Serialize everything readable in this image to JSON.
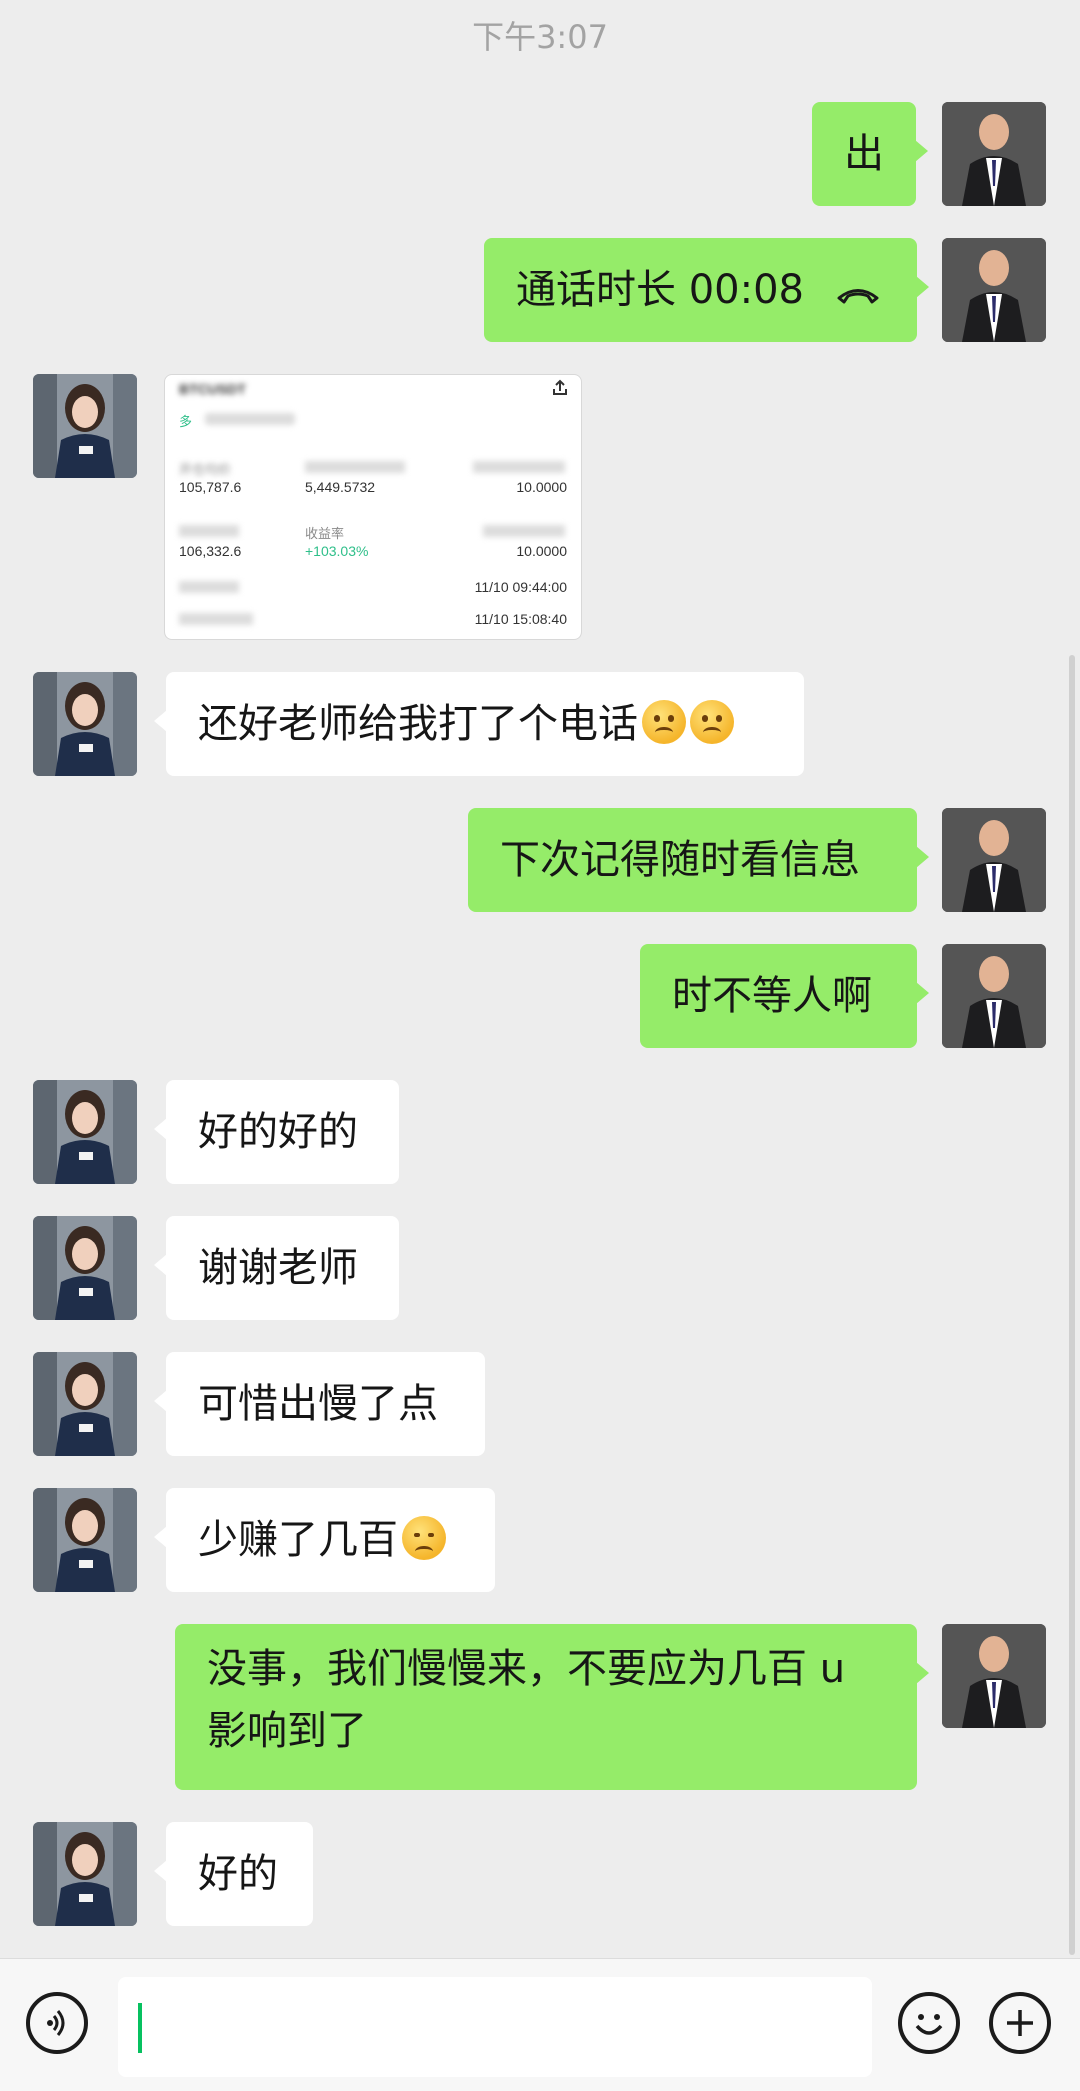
{
  "timestamp": "下午3:07",
  "messages": [
    {
      "side": "me",
      "type": "text",
      "text": "出"
    },
    {
      "side": "me",
      "type": "call",
      "text": "通话时长 00:08",
      "icon": "call-hangup-icon"
    },
    {
      "side": "her",
      "type": "trade-card",
      "card": {
        "pair": "BTCUSDT",
        "direction": "多",
        "labels": [
          "开仓均价",
          "收益率"
        ],
        "values": [
          "105,787.6",
          "5,449.5732",
          "10.0000",
          "106,332.6",
          "+103.03%",
          "10.0000",
          "11/10 09:44:00",
          "11/10 15:08:40"
        ]
      }
    },
    {
      "side": "her",
      "type": "text",
      "text": "还好老师给我打了个电话",
      "emoji": [
        "face-with-tears-icon",
        "face-with-tears-icon"
      ]
    },
    {
      "side": "me",
      "type": "text",
      "text": "下次记得随时看信息"
    },
    {
      "side": "me",
      "type": "text",
      "text": "时不等人啊"
    },
    {
      "side": "her",
      "type": "text",
      "text": "好的好的"
    },
    {
      "side": "her",
      "type": "text",
      "text": "谢谢老师"
    },
    {
      "side": "her",
      "type": "text",
      "text": "可惜出慢了点"
    },
    {
      "side": "her",
      "type": "text",
      "text": "少赚了几百",
      "emoji": [
        "sad-face-icon"
      ]
    },
    {
      "side": "me",
      "type": "text",
      "text": "没事，我们慢慢来，不要应为几百 u 影响到了"
    },
    {
      "side": "her",
      "type": "text",
      "text": "好的"
    }
  ],
  "input": {
    "value": "",
    "placeholder": ""
  },
  "colors": {
    "my_bubble": "#95ec69",
    "her_bubble": "#ffffff",
    "background": "#ededed",
    "caret": "#07c160"
  }
}
